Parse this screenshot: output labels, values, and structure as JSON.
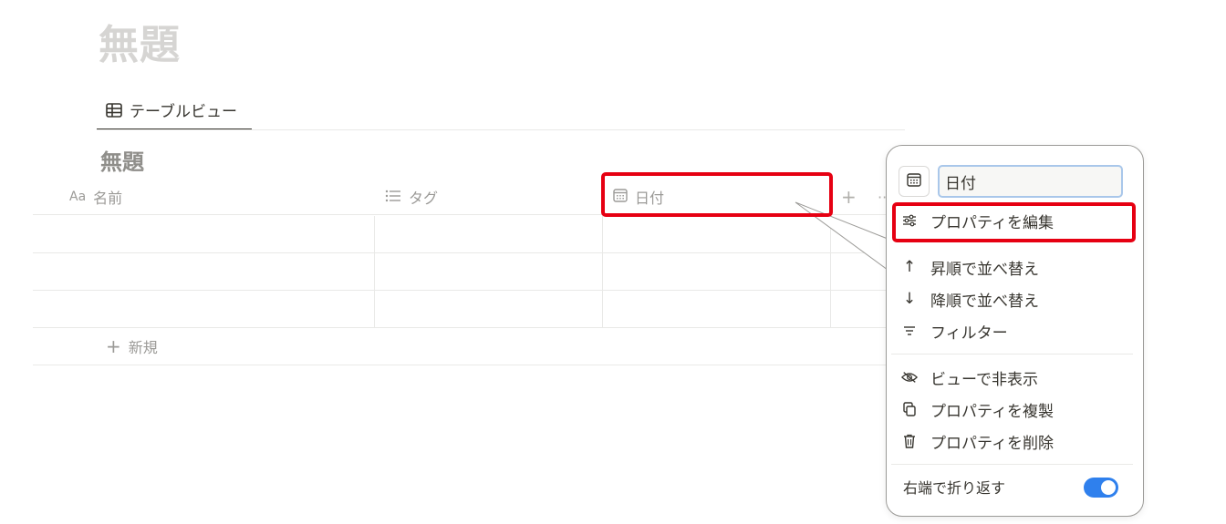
{
  "page": {
    "title": "無題"
  },
  "view_tab": {
    "label": "テーブルビュー",
    "icon": "table-icon"
  },
  "database": {
    "title": "無題",
    "columns": [
      {
        "prefix": "Aa",
        "label": "名前",
        "icon": "text-aa-icon"
      },
      {
        "label": "タグ",
        "icon": "list-icon"
      },
      {
        "label": "日付",
        "icon": "calendar-icon"
      }
    ],
    "add_column": "+",
    "more": "··",
    "new_label": "新規"
  },
  "menu": {
    "name_value": "日付",
    "edit_property": "プロパティを編集",
    "sort_asc": "昇順で並べ替え",
    "sort_desc": "降順で並べ替え",
    "filter": "フィルター",
    "hide": "ビューで非表示",
    "duplicate": "プロパティを複製",
    "delete": "プロパティを削除",
    "wrap": "右端で折り返す",
    "wrap_on": true
  },
  "colors": {
    "highlight": "#e60012",
    "toggle": "#2f80ed",
    "accent_input": "#a9c7ea"
  }
}
